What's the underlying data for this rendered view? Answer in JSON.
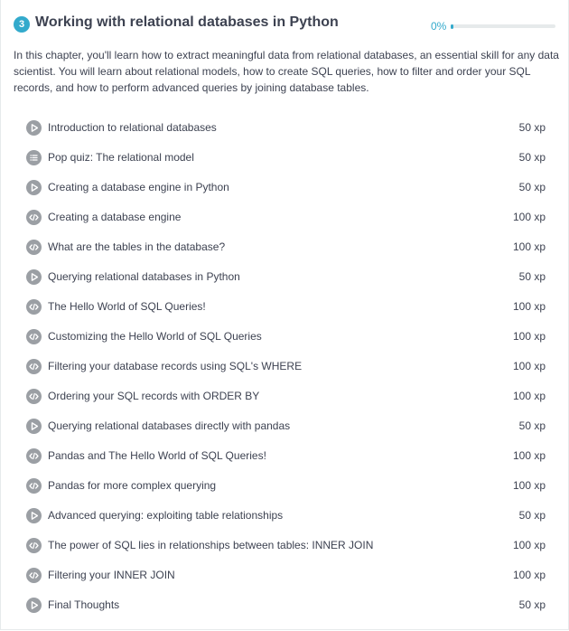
{
  "chapter": {
    "number": "3",
    "title": "Working with relational databases in Python",
    "progress_label": "0%",
    "progress_value": 0,
    "accent_color": "#33aacc",
    "description": "In this chapter, you'll learn how to extract meaningful data from relational databases, an essential skill for any data scientist. You will learn about relational models, how to create SQL queries, how to filter and order your SQL records, and how to perform advanced queries by joining database tables."
  },
  "exercises": [
    {
      "type": "video",
      "icon": "play-icon",
      "title": "Introduction to relational databases",
      "xp": "50 xp"
    },
    {
      "type": "multiple-choice",
      "icon": "list-icon",
      "title": "Pop quiz: The relational model",
      "xp": "50 xp"
    },
    {
      "type": "video",
      "icon": "play-icon",
      "title": "Creating a database engine in Python",
      "xp": "50 xp"
    },
    {
      "type": "coding",
      "icon": "code-icon",
      "title": "Creating a database engine",
      "xp": "100 xp"
    },
    {
      "type": "coding",
      "icon": "code-icon",
      "title": "What are the tables in the database?",
      "xp": "100 xp"
    },
    {
      "type": "video",
      "icon": "play-icon",
      "title": "Querying relational databases in Python",
      "xp": "50 xp"
    },
    {
      "type": "coding",
      "icon": "code-icon",
      "title": "The Hello World of SQL Queries!",
      "xp": "100 xp"
    },
    {
      "type": "coding",
      "icon": "code-icon",
      "title": "Customizing the Hello World of SQL Queries",
      "xp": "100 xp"
    },
    {
      "type": "coding",
      "icon": "code-icon",
      "title": "Filtering your database records using SQL's WHERE",
      "xp": "100 xp"
    },
    {
      "type": "coding",
      "icon": "code-icon",
      "title": "Ordering your SQL records with ORDER BY",
      "xp": "100 xp"
    },
    {
      "type": "video",
      "icon": "play-icon",
      "title": "Querying relational databases directly with pandas",
      "xp": "50 xp"
    },
    {
      "type": "coding",
      "icon": "code-icon",
      "title": "Pandas and The Hello World of SQL Queries!",
      "xp": "100 xp"
    },
    {
      "type": "coding",
      "icon": "code-icon",
      "title": "Pandas for more complex querying",
      "xp": "100 xp"
    },
    {
      "type": "video",
      "icon": "play-icon",
      "title": "Advanced querying: exploiting table relationships",
      "xp": "50 xp"
    },
    {
      "type": "coding",
      "icon": "code-icon",
      "title": "The power of SQL lies in relationships between tables: INNER JOIN",
      "xp": "100 xp"
    },
    {
      "type": "coding",
      "icon": "code-icon",
      "title": "Filtering your INNER JOIN",
      "xp": "100 xp"
    },
    {
      "type": "video",
      "icon": "play-icon",
      "title": "Final Thoughts",
      "xp": "50 xp"
    }
  ]
}
